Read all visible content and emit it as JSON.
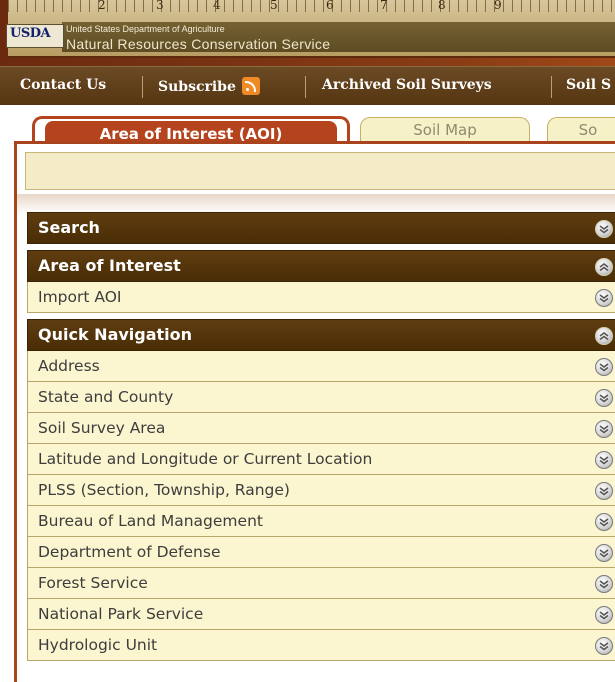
{
  "header": {
    "logo_text": "USDA",
    "agency_line": "United States Department of Agriculture",
    "service_name": "Natural Resources Conservation Service",
    "ruler_numbers": [
      "2",
      "3",
      "4",
      "5",
      "6",
      "7",
      "8",
      "9"
    ]
  },
  "nav": {
    "contact": "Contact Us",
    "subscribe": "Subscribe",
    "archived": "Archived Soil Surveys",
    "cut_item": "Soil S"
  },
  "tabs": {
    "active": "Area of Interest (AOI)",
    "soil_map": "Soil Map",
    "cut": "So"
  },
  "sections": {
    "search": {
      "title": "Search"
    },
    "aoi": {
      "title": "Area of Interest",
      "items": [
        "Import AOI"
      ]
    },
    "quick_nav": {
      "title": "Quick Navigation",
      "items": [
        "Address",
        "State and County",
        "Soil Survey Area",
        "Latitude and Longitude or Current Location",
        "PLSS (Section, Township, Range)",
        "Bureau of Land Management",
        "Department of Defense",
        "Forest Service",
        "National Park Service",
        "Hydrologic Unit"
      ]
    }
  },
  "colors": {
    "accent": "#b5441e",
    "section_header": "#4f3008",
    "row_bg": "#fbf6cf"
  }
}
